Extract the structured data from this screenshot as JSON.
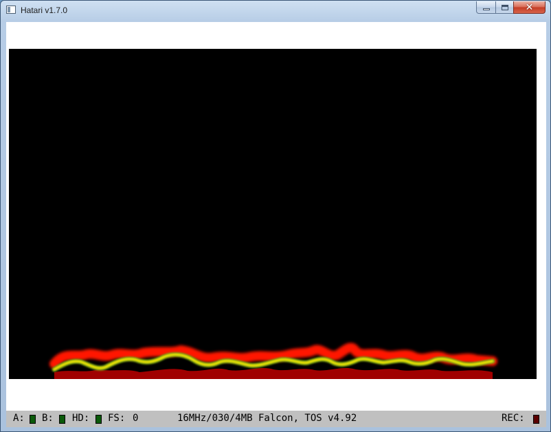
{
  "window": {
    "title": "Hatari v1.7.0"
  },
  "controls": {
    "close_glyph": "✕"
  },
  "status": {
    "drive_a_label": "A:",
    "drive_b_label": "B:",
    "hd_label": "HD:",
    "fs_label": "FS:",
    "fs_value": "0",
    "machine_info": "16MHz/030/4MB Falcon, TOS v4.92",
    "rec_label": "REC:"
  },
  "colors": {
    "led_off": "#0a5a0a",
    "rec_off": "#5a0000",
    "flame_base": "#a00000",
    "flame_red": "#ff1500",
    "flame_yellow": "#ffee00",
    "flame_green": "#6e9a12",
    "screen_bg": "#000000",
    "status_bg": "#c0c0c0"
  }
}
